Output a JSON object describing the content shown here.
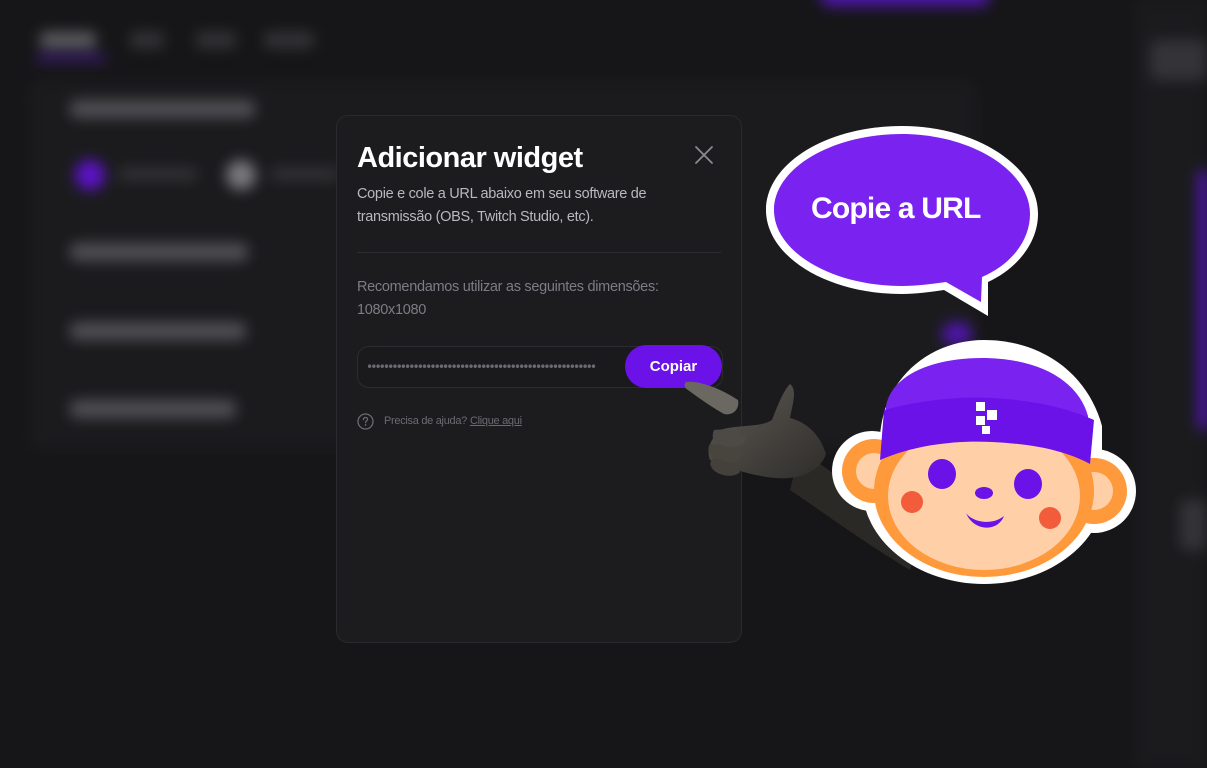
{
  "modal": {
    "title": "Adicionar widget",
    "description": "Copie e cole a URL abaixo em seu software de transmissão (OBS, Twitch Studio, etc).",
    "recommendation": "Recomendamos utilizar as seguintes dimensões: 1080x1080",
    "url_value": "••••••••••••••••••••••••••••••••••••••••••••••••••••••",
    "copy_label": "Copiar",
    "help_text": "Precisa de ajuda?",
    "help_link": "Clique aqui",
    "close_icon": "close-icon",
    "help_icon": "question-circle-icon"
  },
  "bubble": {
    "text": "Copie a URL"
  },
  "colors": {
    "accent": "#6a12e8",
    "bubble": "#7a22f0",
    "modal_bg": "#1c1c1f",
    "page_bg": "#161618",
    "mascot_face": "#ffd0a8",
    "mascot_ears": "#ff9a3c"
  }
}
